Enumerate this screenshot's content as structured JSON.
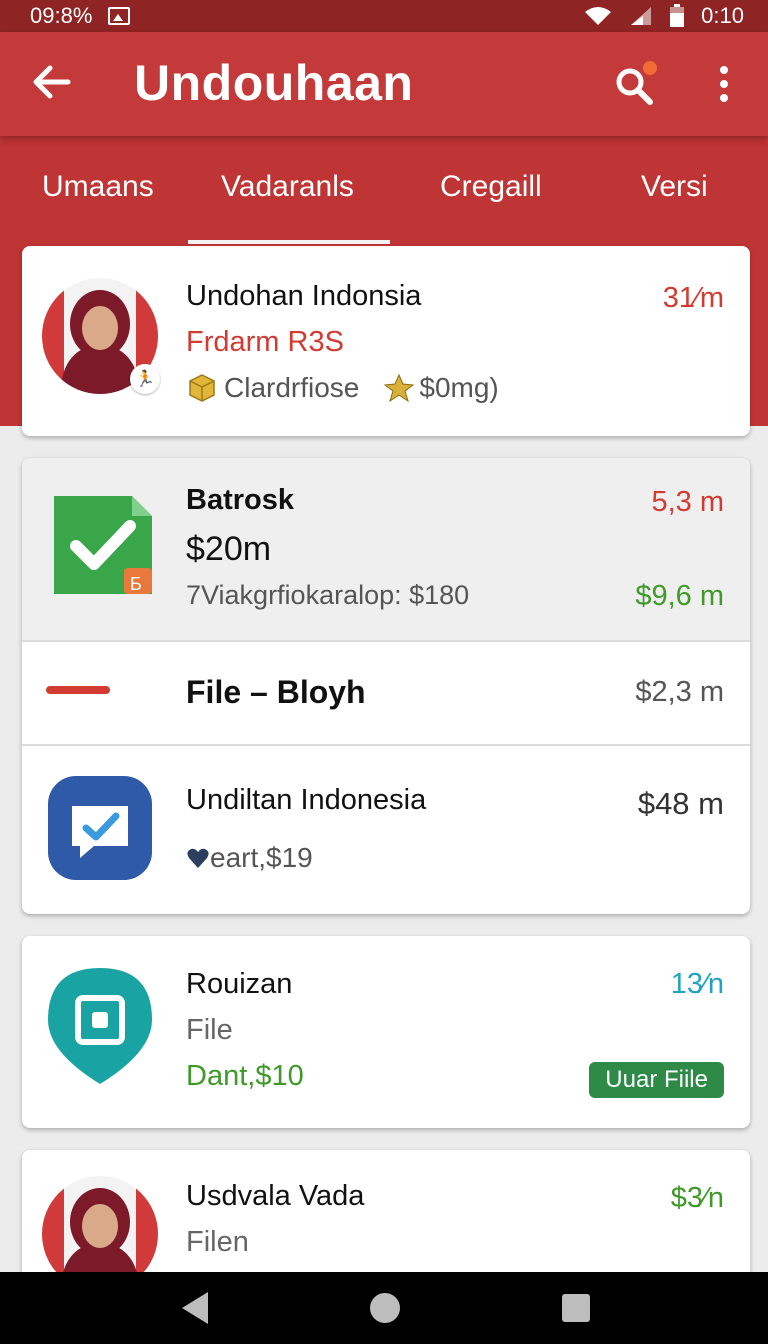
{
  "status_bar": {
    "left_text": "09:8%",
    "time": "0:10"
  },
  "app_bar": {
    "title": "Undouhaan"
  },
  "tabs": [
    {
      "label": "Umaans"
    },
    {
      "label": "Vadaranls",
      "active": true
    },
    {
      "label": "Cregaill"
    },
    {
      "label": "Versi"
    }
  ],
  "cards": {
    "profile": {
      "title": "Undohan Indonsia",
      "subtitle": "Frdarm R3S",
      "tag1": "Clardrfiose",
      "tag2": "$0mg)",
      "value": "31⁄m"
    },
    "batrosk": {
      "title": "Batrosk",
      "amount": "$20m",
      "detail": "7Viakgrfiokaralop: $180",
      "value_top": "5,3 m",
      "value_bottom": "$9,6 m",
      "icon_badge": "Б"
    },
    "file_bloyh": {
      "title": "File – Bloyh",
      "value": "$2,3 m"
    },
    "undiltan": {
      "title": "Undiltan Indonesia",
      "sub": "eart,$19",
      "value": "$48 m"
    },
    "rouizan": {
      "title": "Rouizan",
      "sub1": "File",
      "sub2": "Dant,$10",
      "value": "13⁄n",
      "button": "Uuar Fiile"
    },
    "usdvala": {
      "title": "Usdvala Vada",
      "sub": "Filen",
      "value": "$3⁄n"
    }
  },
  "colors": {
    "primary": "#c43a3a",
    "status_bar": "#8e2424",
    "red_text": "#d23b32",
    "green_text": "#3f9a2a",
    "teal_text": "#21a4c0",
    "gray_text": "#555555",
    "green_button": "#2e8b47"
  }
}
